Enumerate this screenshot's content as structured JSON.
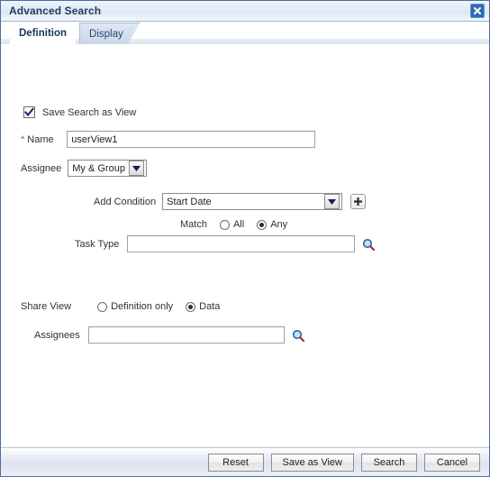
{
  "dialog": {
    "title": "Advanced Search",
    "close_label": "Close"
  },
  "tabs": [
    {
      "label": "Definition",
      "active": true
    },
    {
      "label": "Display",
      "active": false
    }
  ],
  "form": {
    "save_search_as_view": {
      "label": "Save Search as View",
      "checked": true
    },
    "name": {
      "label": "Name",
      "required_marker": "*",
      "value": "userView1",
      "placeholder": ""
    },
    "assignee": {
      "label": "Assignee",
      "value": "My & Group"
    },
    "add_condition": {
      "label": "Add Condition",
      "value": "Start Date",
      "add_button_label": "+"
    },
    "match": {
      "label": "Match",
      "options": [
        "All",
        "Any"
      ],
      "selected": "Any"
    },
    "task_type": {
      "label": "Task Type",
      "value": "",
      "placeholder": "",
      "search_icon": "search-icon"
    },
    "share_view": {
      "label": "Share View",
      "options": [
        "Definition only",
        "Data"
      ],
      "selected": "Data"
    },
    "assignees": {
      "label": "Assignees",
      "value": "",
      "placeholder": "",
      "search_icon": "search-icon"
    }
  },
  "footer": {
    "buttons": [
      {
        "label": "Reset"
      },
      {
        "label": "Save as View"
      },
      {
        "label": "Search"
      },
      {
        "label": "Cancel"
      }
    ]
  }
}
